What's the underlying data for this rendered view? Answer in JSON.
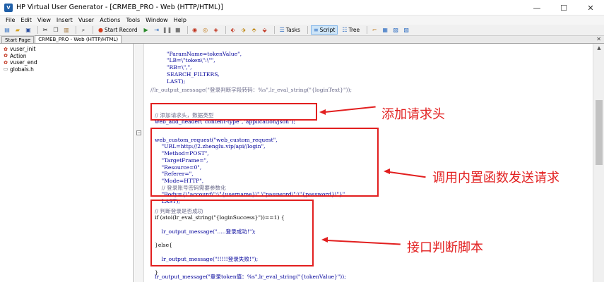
{
  "window": {
    "title": "HP Virtual User Generator - [CRMEB_PRO - Web (HTTP/HTML)]",
    "icon_label": "V",
    "minimize": "—",
    "maximize": "☐",
    "close": "✕"
  },
  "menu": [
    "File",
    "Edit",
    "View",
    "Insert",
    "Vuser",
    "Actions",
    "Tools",
    "Window",
    "Help"
  ],
  "toolbar": {
    "start_record": "Start Record",
    "tasks": "Tasks",
    "script": "Script",
    "tree": "Tree"
  },
  "tabs": {
    "start_page": "Start Page",
    "active": "CRMEB_PRO - Web (HTTP/HTML)",
    "close": "✕"
  },
  "tree": {
    "items": [
      "vuser_init",
      "Action",
      "vuser_end",
      "globals.h"
    ]
  },
  "code": {
    "block1": [
      "\"ParamName=tokenValue\",",
      "\"LB=\\\"token\\\":\\\"\",",
      "\"RB=\\\",\",",
      "SEARCH_FILTERS,",
      "LAST);"
    ],
    "comment_output": "//lr_output_message(\"登录判断字段转码：%s\",lr_eval_string(\"{loginText}\"));",
    "header_comment": "// 添加请求头，数据类型",
    "header_call": "web_add_header(\"content-type\",\"application/json\");",
    "request_lines": [
      "web_custom_request(\"web_custom_request\",",
      "    \"URL=http://2.zhenglu.vip/api//login\",",
      "    \"Method=POST\",",
      "    \"TargetFrame=\",",
      "    \"Resource=0\",",
      "    \"Referer=\",",
      "    \"Mode=HTTP\",",
      "    // 登录账号密码需要参数化",
      "    \"Body={\\\"account\\\":\\\"{username}\\\",\\\"password\\\":\\\"{password}\\\"}\",",
      "    LAST);"
    ],
    "judge_lines": [
      "// 判断登录是否成功",
      "if (atoi(lr_eval_string(\"{loginSuccess}\"))==1) {",
      "",
      "    lr_output_message(\".....登录成功!\");",
      "",
      "}else{",
      "",
      "    lr_output_message(\"!!!!!登录失败!\");",
      "",
      "}"
    ],
    "token_line": "lr_output_message(\"登录token值：%s\",lr_eval_string(\"{tokenValue}\"));"
  },
  "annotations": {
    "header": "添加请求头",
    "request": "调用内置函数发送请求",
    "judge": "接口判断脚本"
  },
  "colors": {
    "highlight": "#e21f1f",
    "code_text": "#00009a"
  }
}
